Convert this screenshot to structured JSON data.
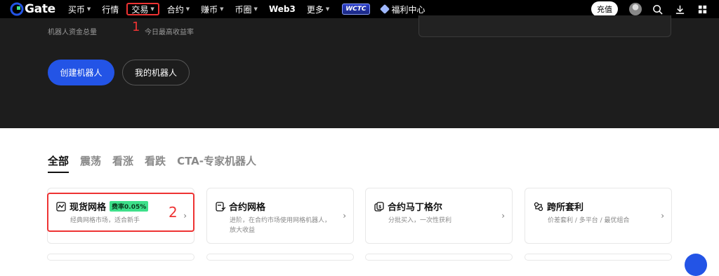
{
  "nav": {
    "logo_text": "Gate",
    "items": [
      {
        "label": "买币",
        "caret": true
      },
      {
        "label": "行情",
        "caret": false
      },
      {
        "label": "交易",
        "caret": true
      },
      {
        "label": "合约",
        "caret": true
      },
      {
        "label": "赚币",
        "caret": true
      },
      {
        "label": "币圈",
        "caret": true
      },
      {
        "label": "Web3",
        "caret": false
      },
      {
        "label": "更多",
        "caret": true
      }
    ],
    "wctc_badge": "WCTC",
    "gift_center": "福利中心",
    "deposit_label": "充值"
  },
  "annotations": {
    "one": "1",
    "two": "2"
  },
  "hero": {
    "total_funds_label": "机器人资金总量",
    "today_max_yield_label": "今日最高收益率",
    "create_button": "创建机器人",
    "my_bots_button": "我的机器人"
  },
  "tabs": [
    "全部",
    "震荡",
    "看涨",
    "看跌",
    "CTA-专家机器人"
  ],
  "cards": [
    {
      "title": "现货网格",
      "badge": "费率0.05%",
      "desc": "经典网格市场，适合新手",
      "icon": "chart-line-icon"
    },
    {
      "title": "合约网格",
      "badge": "",
      "desc": "进阶，在合约市场使用网格机器人，放大收益",
      "icon": "contract-grid-icon"
    },
    {
      "title": "合约马丁格尔",
      "badge": "",
      "desc": "分批买入，一次性获利",
      "icon": "martingale-icon"
    },
    {
      "title": "跨所套利",
      "badge": "",
      "desc": "价差套利 / 多平台 / 最优组合",
      "icon": "arbitrage-icon"
    }
  ],
  "colors": {
    "accent": "#2354e6",
    "annotation": "#e33333",
    "fee_badge": "#3ee08a"
  }
}
